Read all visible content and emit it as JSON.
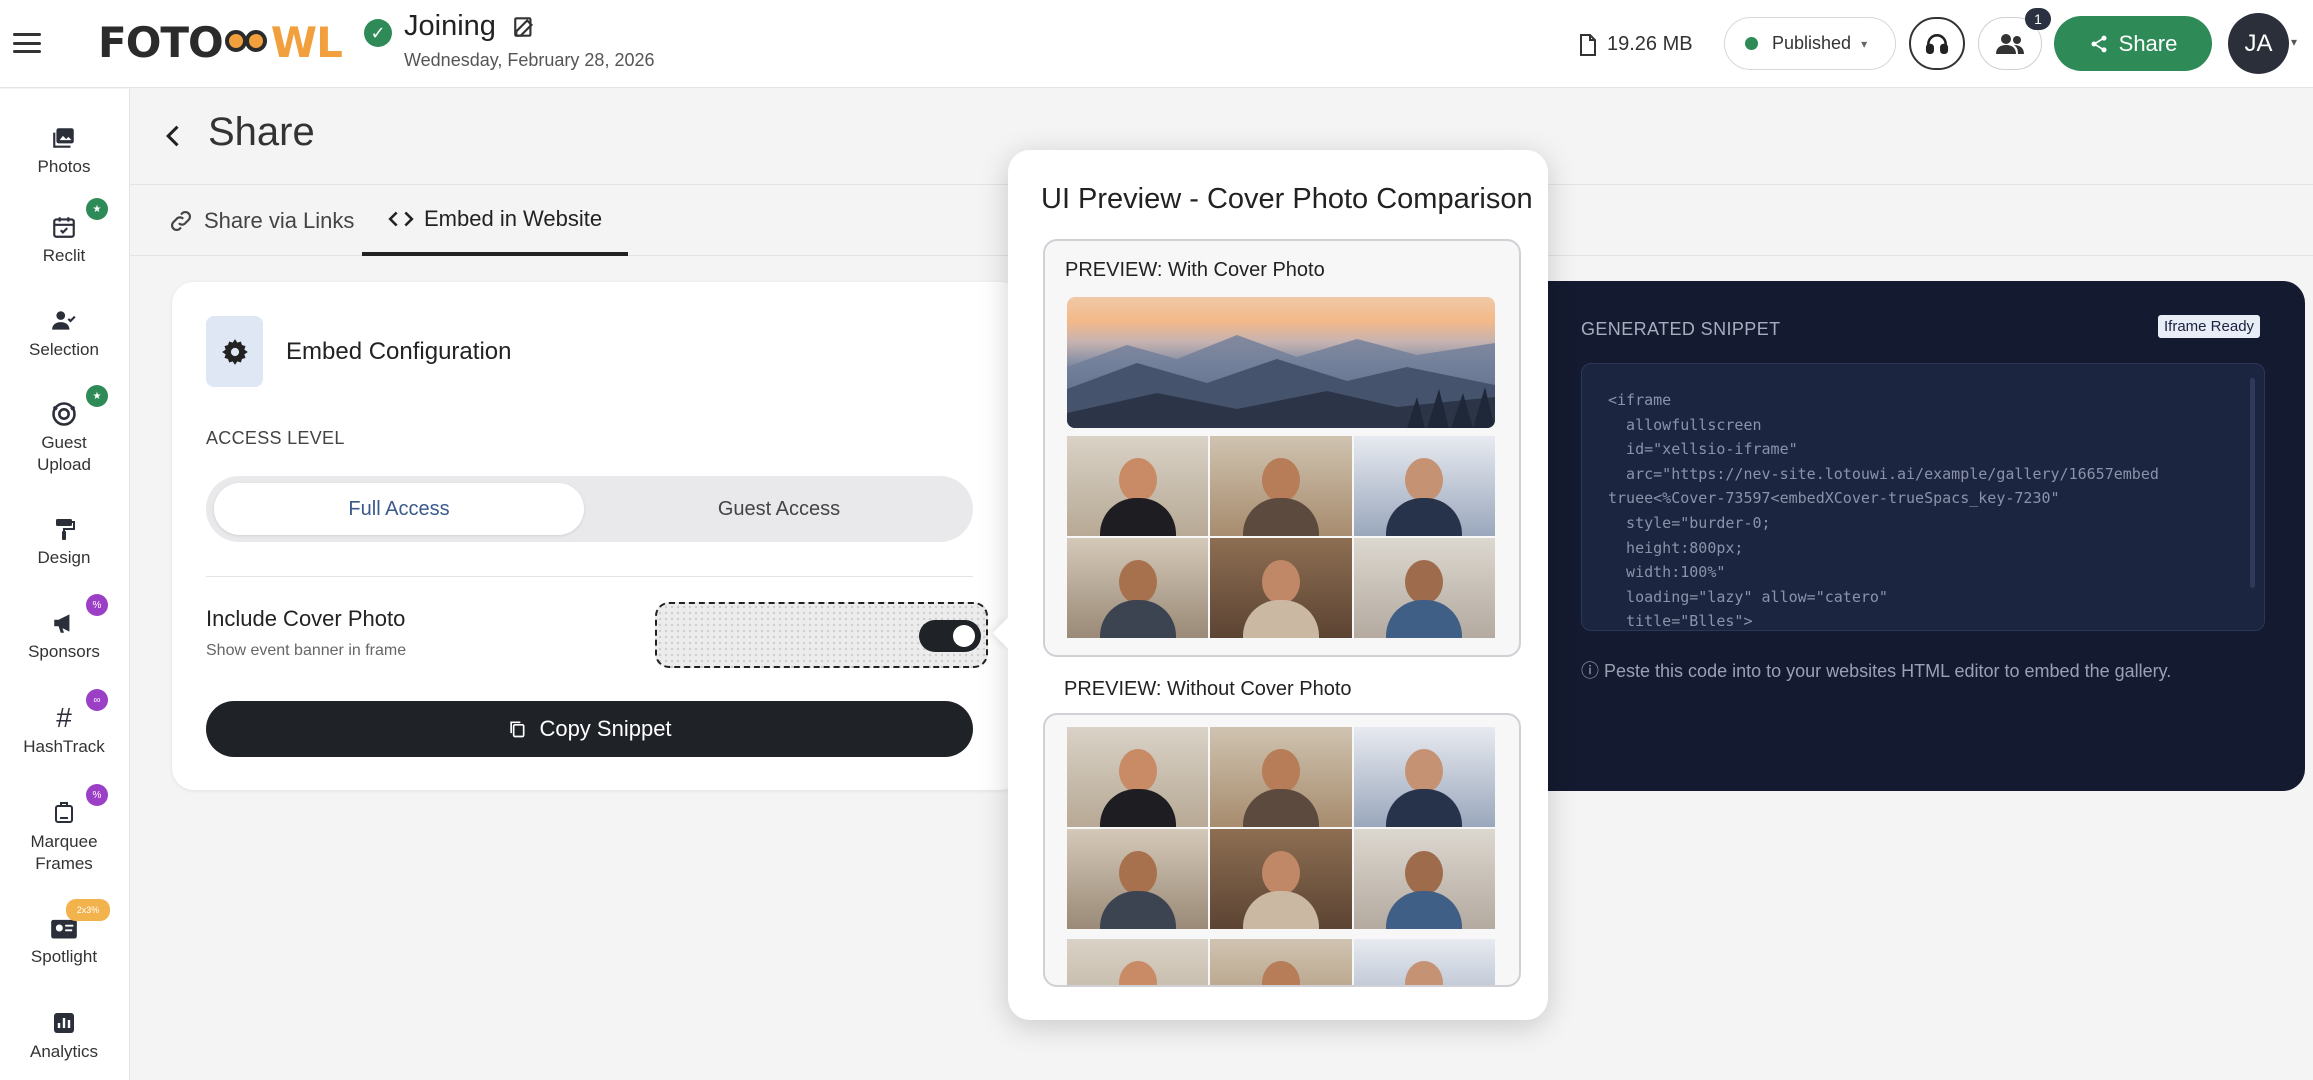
{
  "app": {
    "logo_text_a": "FOTO",
    "logo_text_b": "WL"
  },
  "event": {
    "title": "Joining",
    "date": "Wednesday, February 28, 2026"
  },
  "header": {
    "storage": "19.26 MB",
    "status": "Published",
    "team_count": "1",
    "share_label": "Share",
    "avatar_initials": "JA"
  },
  "sidebar": {
    "items": [
      {
        "label": "Photos"
      },
      {
        "label": "Reclit",
        "badge": "★"
      },
      {
        "label": "Selection"
      },
      {
        "label": "Guest Upload",
        "badge": "★"
      },
      {
        "label": "Design"
      },
      {
        "label": "Sponsors",
        "badge": "%"
      },
      {
        "label": "HashTrack",
        "badge": "∞"
      },
      {
        "label": "Marquee Frames",
        "badge": "%"
      },
      {
        "label": "Spotlight",
        "badge": "2x3%"
      },
      {
        "label": "Analytics"
      }
    ]
  },
  "page": {
    "title": "Share"
  },
  "tabs": [
    {
      "label": "Share via Links"
    },
    {
      "label": "Embed in Website",
      "active": true
    }
  ],
  "config": {
    "title": "Embed Configuration",
    "access_label": "ACCESS LEVEL",
    "access_options": [
      "Full Access",
      "Guest Access"
    ],
    "access_selected": "Full Access",
    "cover_label": "Include Cover Photo",
    "cover_sub": "Show event banner in frame",
    "cover_enabled": true,
    "copy_label": "Copy Snippet"
  },
  "snippet": {
    "title": "GENERATED SNIPPET",
    "badge": "Iframe Ready",
    "code": "<iframe\n  allowfullscreen\n  id=\"xellsio-iframe\"\n  arc=\"https://nev-site.lotouwi.ai/example/gallery/16657embed\ntruee<%Cover-73597<embedXCover-trueSpacs_key-7230\"\n  style=\"burder-0;\n  height:800px;\n  width:100%\"\n  loading=\"lazy\" allow=\"catero\"\n  title=\"Blles\">",
    "hint": "Peste this code into to your websites HTML editor to embed the gallery."
  },
  "preview": {
    "title": "UI Preview - Cover Photo Comparison",
    "with_label": "PREVIEW: With Cover Photo",
    "without_label": "PREVIEW: Without Cover Photo"
  },
  "colors": {
    "brand_green": "#2e8b57",
    "snippet_bg": "#141b30",
    "dark": "#1f2328",
    "logo_orange": "#f2a03d"
  }
}
